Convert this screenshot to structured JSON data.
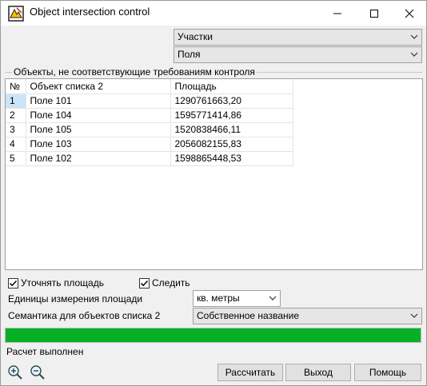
{
  "window": {
    "title": "Object intersection control"
  },
  "filters": {
    "combo1": "Участки",
    "combo2": "Поля"
  },
  "group": {
    "title": "Объекты, не соответствующие требованиям контроля"
  },
  "table": {
    "headers": [
      "№",
      "Объект списка 2",
      "Площадь"
    ],
    "rows": [
      [
        "1",
        "Поле 101",
        "1290761663,20"
      ],
      [
        "2",
        "Поле 104",
        "1595771414,86"
      ],
      [
        "3",
        "Поле 105",
        "1520838466,11"
      ],
      [
        "4",
        "Поле 103",
        "2056082155,83"
      ],
      [
        "5",
        "Поле 102",
        "1598865448,53"
      ]
    ]
  },
  "options": {
    "refine_area_label": "Уточнять площадь",
    "refine_area_checked": true,
    "track_label": "Следить",
    "track_checked": true
  },
  "units": {
    "label": "Единицы измерения площади",
    "value": "кв. метры"
  },
  "semantics": {
    "label": "Семантика для объектов списка 2",
    "value": "Собственное название"
  },
  "progress": {
    "percent": 100,
    "color": "#06b025"
  },
  "status": {
    "text": "Расчет выполнен"
  },
  "buttons": {
    "calculate": "Рассчитать",
    "exit": "Выход",
    "help": "Помощь"
  },
  "icons": {
    "zoom_in": "zoom-in-icon",
    "zoom_out": "zoom-out-icon"
  }
}
